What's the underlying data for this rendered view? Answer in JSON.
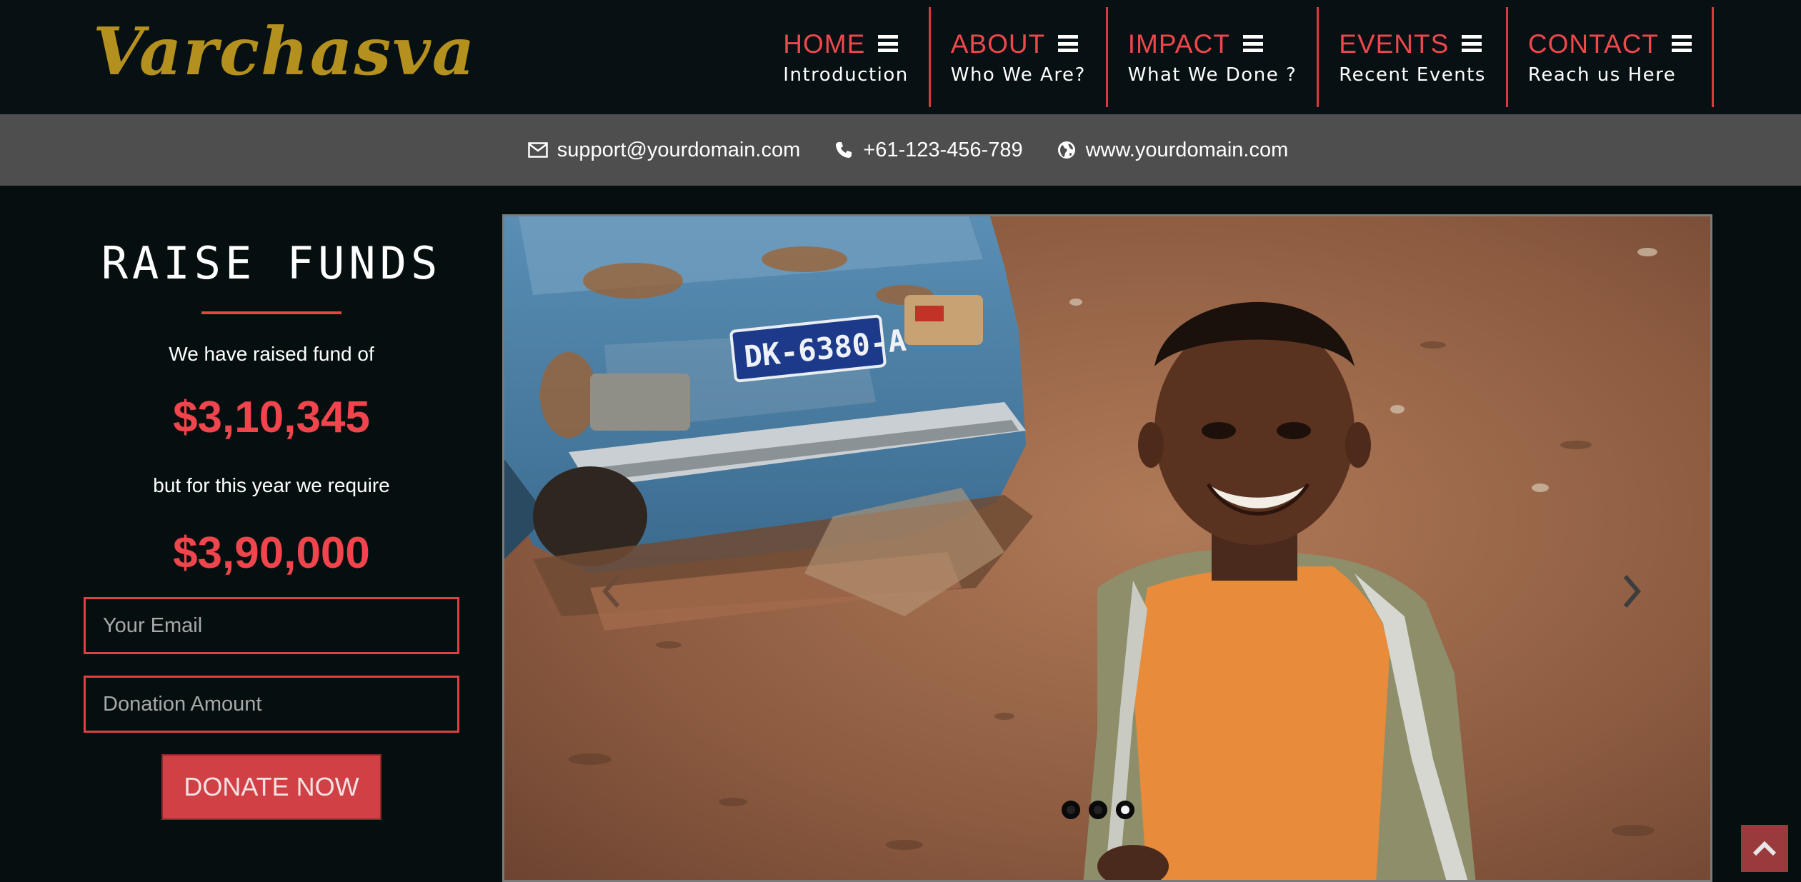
{
  "brand": {
    "logo_text": "Varchasva",
    "logo_color": "#b4901f"
  },
  "nav": {
    "items": [
      {
        "title": "HOME",
        "subtitle": "Introduction"
      },
      {
        "title": "ABOUT",
        "subtitle": "Who We Are?"
      },
      {
        "title": "IMPACT",
        "subtitle": "What We Done ?"
      },
      {
        "title": "EVENTS",
        "subtitle": "Recent Events"
      },
      {
        "title": "CONTACT",
        "subtitle": "Reach us Here"
      }
    ],
    "menu_icon": "bars-icon",
    "accent_color": "#f0474c"
  },
  "contact_bar": {
    "email": "support@yourdomain.com",
    "phone": "+61-123-456-789",
    "website": "www.yourdomain.com",
    "icons": [
      "envelope-icon",
      "phone-icon",
      "globe-icon"
    ]
  },
  "fund": {
    "title": "RAISE FUNDS",
    "raised_text": "We have raised fund of",
    "raised_amount": "$3,10,345",
    "require_text": "but for this year we require",
    "require_amount": "$3,90,000",
    "email_placeholder": "Your Email",
    "amount_placeholder": "Donation Amount",
    "donate_label": "DONATE NOW",
    "accent_color": "#f0454c"
  },
  "slider": {
    "license_plate": "DK-6380-A",
    "slide_count": 3,
    "active_slide": 3,
    "prev_icon": "chevron-left-icon",
    "next_icon": "chevron-right-icon"
  },
  "back_to_top": {
    "icon": "chevron-up-icon",
    "color": "#9b3a3c"
  }
}
